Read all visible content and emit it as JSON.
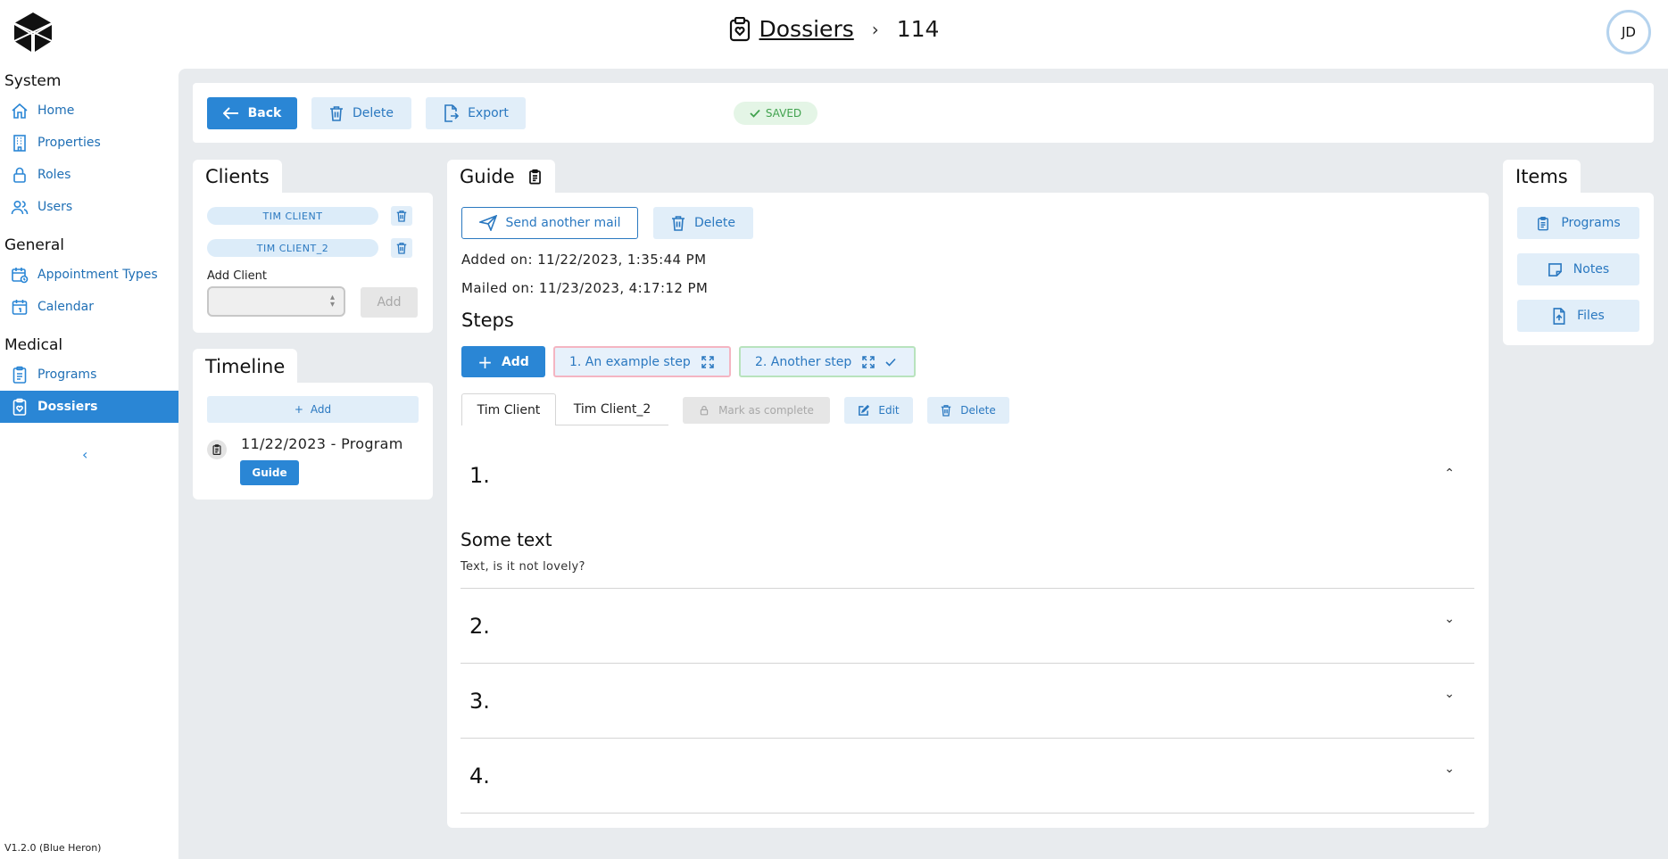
{
  "header": {
    "breadcrumb_root": "Dossiers",
    "breadcrumb_separator": "›",
    "breadcrumb_current": "114",
    "avatar_initials": "JD"
  },
  "sidebar": {
    "groups": [
      {
        "title": "System",
        "items": [
          {
            "label": "Home",
            "icon": "home-icon"
          },
          {
            "label": "Properties",
            "icon": "building-icon"
          },
          {
            "label": "Roles",
            "icon": "lock-icon"
          },
          {
            "label": "Users",
            "icon": "users-icon"
          }
        ]
      },
      {
        "title": "General",
        "items": [
          {
            "label": "Appointment Types",
            "icon": "calendar-clock-icon"
          },
          {
            "label": "Calendar",
            "icon": "calendar-icon"
          }
        ]
      },
      {
        "title": "Medical",
        "items": [
          {
            "label": "Programs",
            "icon": "clipboard-icon"
          },
          {
            "label": "Dossiers",
            "icon": "clipboard-heart-icon",
            "active": true
          }
        ]
      }
    ],
    "collapse_glyph": "‹",
    "version": "V1.2.0 (Blue Heron)"
  },
  "toolbar": {
    "back_label": "Back",
    "delete_label": "Delete",
    "export_label": "Export",
    "saved_label": "SAVED"
  },
  "clients": {
    "title": "Clients",
    "chips": [
      "TIM CLIENT",
      "TIM CLIENT_2"
    ],
    "add_client_label": "Add Client",
    "add_button": "Add"
  },
  "timeline": {
    "title": "Timeline",
    "add_button": "Add",
    "entry_text": "11/22/2023 - Program",
    "entry_button": "Guide"
  },
  "guide": {
    "title": "Guide",
    "send_mail_button": "Send another mail",
    "delete_button": "Delete",
    "added_on": "Added on: 11/22/2023, 1:35:44 PM",
    "mailed_on": "Mailed on: 11/23/2023, 4:17:12 PM",
    "steps_title": "Steps",
    "add_step_button": "Add",
    "step_pills": [
      "1. An example step",
      "2. Another step"
    ],
    "client_tabs": [
      "Tim Client",
      "Tim Client_2"
    ],
    "mark_complete_button": "Mark as complete",
    "edit_button": "Edit",
    "step_delete_button": "Delete",
    "accordion": [
      {
        "number": "1.",
        "expanded": true,
        "heading": "Some text",
        "body": "Text, is it not lovely?"
      },
      {
        "number": "2.",
        "expanded": false
      },
      {
        "number": "3.",
        "expanded": false
      },
      {
        "number": "4.",
        "expanded": false
      }
    ],
    "chevron_up": "⌃",
    "chevron_down": "⌄"
  },
  "items": {
    "title": "Items",
    "buttons": [
      "Programs",
      "Notes",
      "Files"
    ]
  },
  "colors": {
    "primary": "#2a86d5",
    "light": "#e1eef9",
    "saved": "#41a24e",
    "background": "#e8ebee"
  }
}
